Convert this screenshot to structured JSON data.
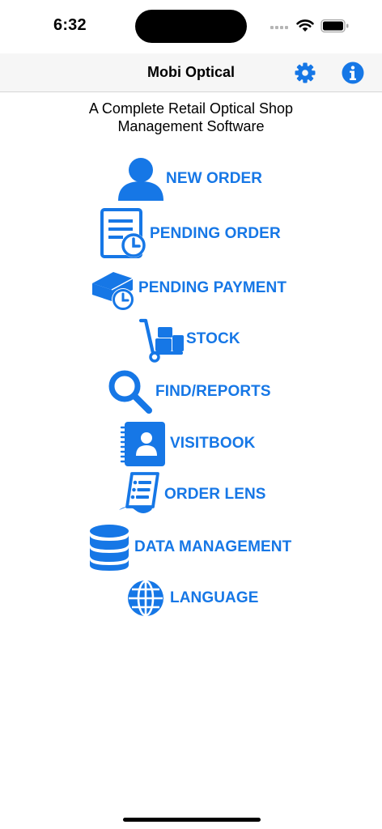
{
  "status_bar": {
    "time": "6:32"
  },
  "nav": {
    "title": "Mobi Optical",
    "settings_icon": "gear-icon",
    "info_icon": "info-icon"
  },
  "subtitle": {
    "line1": "A Complete Retail Optical Shop",
    "line2": "Management Software"
  },
  "menu": {
    "accent_color": "#1677e6",
    "items": [
      {
        "label": "NEW ORDER",
        "icon": "person-icon"
      },
      {
        "label": "PENDING ORDER",
        "icon": "document-clock-icon"
      },
      {
        "label": "PENDING PAYMENT",
        "icon": "money-clock-icon"
      },
      {
        "label": "STOCK",
        "icon": "hand-truck-icon"
      },
      {
        "label": "FIND/REPORTS",
        "icon": "magnifier-icon"
      },
      {
        "label": "VISITBOOK",
        "icon": "contact-book-icon"
      },
      {
        "label": "ORDER LENS",
        "icon": "receipt-list-icon"
      },
      {
        "label": "DATA MANAGEMENT",
        "icon": "database-icon"
      },
      {
        "label": "LANGUAGE",
        "icon": "globe-icon"
      }
    ]
  }
}
